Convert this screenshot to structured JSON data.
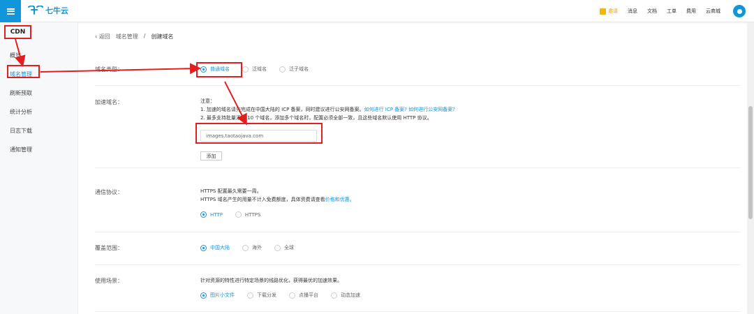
{
  "header": {
    "brand": "七牛云",
    "nav": [
      "邀请",
      "消息",
      "文档",
      "工单",
      "费用",
      "云商城"
    ]
  },
  "sidebar": {
    "title": "CDN",
    "items": [
      {
        "label": "概览"
      },
      {
        "label": "域名管理"
      },
      {
        "label": "刷新预取"
      },
      {
        "label": "统计分析"
      },
      {
        "label": "日志下载"
      },
      {
        "label": "通知管理"
      }
    ]
  },
  "breadcrumb": {
    "back": "返回",
    "section": "域名管理",
    "separator": "/",
    "current": "创建域名"
  },
  "domain_type": {
    "label": "域名类型：",
    "options": [
      "普通域名",
      "泛域名",
      "泛子域名"
    ],
    "selected": "普通域名"
  },
  "accel_domain": {
    "label": "加速域名：",
    "note_title": "注意：",
    "note1": "1. 加速的域名请先完成在中国大陆的 ICP 备案，同时建议进行公安网备案。",
    "note1_link1": "如何进行 ICP 备案?",
    "note1_link2": "如何进行公安网备案?",
    "note2": "2. 最多支持批量添加 10 个域名，添加多个域名时，配置必须全部一致，且这些域名默认使用 HTTP 协议。",
    "input_value": "images.taotaojava.com",
    "add_button": "添加"
  },
  "protocol": {
    "label": "通信协议：",
    "line1": "HTTPS 配置最久需要一周。",
    "line2": "HTTPS 域名产生的用量不计入免费额度，具体资费请查看",
    "line2_link": "价格和优惠。",
    "options": [
      "HTTP",
      "HTTPS"
    ],
    "selected": "HTTP"
  },
  "coverage": {
    "label": "覆盖范围：",
    "options": [
      "中国大陆",
      "海外",
      "全球"
    ],
    "selected": "中国大陆"
  },
  "scenario": {
    "label": "使用场景：",
    "desc": "针对资源的特性进行特定场景的线路优化，获得最优的加速效果。",
    "options": [
      "图片小文件",
      "下载分发",
      "点播平台",
      "动态加速"
    ],
    "selected": "图片小文件"
  },
  "colors": {
    "accent": "#1296db",
    "annotation": "#e02020",
    "invite": "#f0a000"
  }
}
